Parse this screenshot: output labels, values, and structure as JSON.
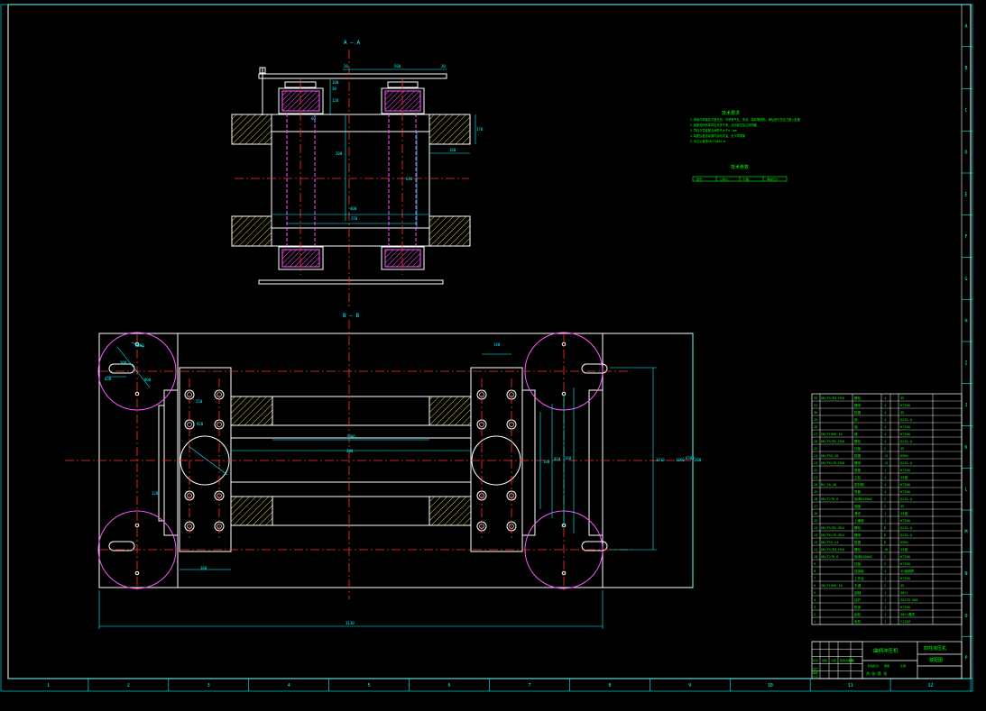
{
  "drawing": {
    "section_aa": "A — A",
    "section_bb": "B — B",
    "notes_title": "技术要求",
    "notes": [
      "1.焊接件焊缝应平整光滑，不得有气孔、夹渣、裂纹等缺陷，焊后进行去应力退火处理",
      "2.装配前所有零件应清洗干净，活动部位加注润滑脂",
      "3.导柱与导套配合间隙不大于0.1mm",
      "4.装配后各活动部件运动灵活，无卡滞现象",
      "5.未注公差按GB/T1804-m"
    ],
    "params_title": "技术参数",
    "params_cols": [
      "型号",
      "公称力",
      "行程",
      "滑块尺寸"
    ],
    "top_dims": [
      "20",
      "560",
      "20",
      "100",
      "30",
      "120",
      "60",
      "200",
      "400",
      "370",
      "640",
      "170",
      "160"
    ],
    "plan_dims": [
      "140",
      "R200",
      "300",
      "830",
      "900",
      "550",
      "920",
      "1000",
      "200",
      "100",
      "810",
      "1010",
      "200",
      "120",
      "360",
      "160",
      "6500"
    ],
    "overall_width": "3130",
    "overall_height": "1060",
    "ruler_bottom": [
      "1",
      "2",
      "3",
      "4",
      "5",
      "6",
      "7",
      "8",
      "9",
      "10",
      "11",
      "12"
    ],
    "ruler_right": [
      "A",
      "B",
      "C",
      "D",
      "E",
      "F",
      "G",
      "H",
      "I",
      "J",
      "K",
      "L",
      "M",
      "N",
      "O",
      "P"
    ]
  },
  "bom": {
    "rows": [
      [
        "32",
        "GB/T5783-M16",
        "螺栓",
        "4",
        "",
        "45"
      ],
      [
        "31",
        "",
        "螺母",
        "4",
        "",
        "HT200"
      ],
      [
        "30",
        "",
        "垫圈",
        "4",
        "",
        "35"
      ],
      [
        "29",
        "",
        "销",
        "4",
        "",
        "Q235-A"
      ],
      [
        "28",
        "",
        "轴",
        "4",
        "",
        "HT150"
      ],
      [
        "27",
        "GB/T1096-16",
        "键",
        "4",
        "",
        "HT200"
      ],
      [
        "26",
        "GB/T5782-M20",
        "螺栓",
        "4",
        "",
        "Q235-A"
      ],
      [
        "25",
        "",
        "挡板",
        "2",
        "",
        "45"
      ],
      [
        "24",
        "GB/T93-20",
        "垫圈",
        "12",
        "",
        "65Mn"
      ],
      [
        "23",
        "GB/T6170-M20",
        "螺母",
        "12",
        "",
        "Q235-A"
      ],
      [
        "22",
        "",
        "底座",
        "1",
        "",
        "HT150"
      ],
      [
        "21",
        "",
        "立柱",
        "4",
        "",
        "45钢"
      ],
      [
        "20",
        "Mc-16-40",
        "密封圈",
        "4",
        "",
        "HT300"
      ],
      [
        "19",
        "",
        "导套",
        "4",
        "",
        "HT200"
      ],
      [
        "18",
        "GB/T276-6",
        "轴承6208AC",
        "2",
        "",
        "Q235-A"
      ],
      [
        "17",
        "",
        "端盖",
        "2",
        "",
        "45"
      ],
      [
        "16",
        "",
        "滑块",
        "1",
        "",
        "45钢"
      ],
      [
        "15",
        "",
        "上横梁",
        "1",
        "",
        "HT200"
      ],
      [
        "14",
        "GB/T5782-M24",
        "螺栓",
        "8",
        "",
        "Q235-A"
      ],
      [
        "13",
        "GB/T6170-M24",
        "螺母",
        "8",
        "",
        "Q235-A"
      ],
      [
        "12",
        "GB/T93-24",
        "垫圈",
        "8",
        "",
        "65Mn"
      ],
      [
        "11",
        "GB/T5783-M16",
        "螺栓",
        "16",
        "",
        "45钢"
      ],
      [
        "10",
        "GB/T276-6",
        "轴承6306AC",
        "2",
        "",
        "HT200"
      ],
      [
        "9",
        "",
        "压板",
        "2",
        "",
        "HT150"
      ],
      [
        "8",
        "",
        "连接板",
        "4",
        "",
        "45钢调质"
      ],
      [
        "7",
        "",
        "工作台",
        "1",
        "",
        "HT150"
      ],
      [
        "6",
        "GB/T1096-10",
        "平键",
        "2",
        "",
        "45"
      ],
      [
        "5",
        "",
        "曲轴",
        "1",
        "",
        "40Cr"
      ],
      [
        "4",
        "",
        "连杆",
        "1",
        "",
        "ZG270-500"
      ],
      [
        "3",
        "",
        "机身",
        "1",
        "",
        "HT250"
      ],
      [
        "2",
        "",
        "齿轮",
        "1",
        "",
        "40Cr调质"
      ],
      [
        "1",
        "",
        "电机",
        "1",
        "",
        "Y132M"
      ]
    ],
    "title_left": "曲柄冲压机",
    "title_right_top": "四柱液压机",
    "title_right_bottom": "装配图",
    "stamp_cols": [
      "标记",
      "处数",
      "分区",
      "更改文件号",
      "签名",
      "年月日"
    ],
    "stamp_rows": [
      "设计",
      "审核",
      "工艺"
    ],
    "weight_labels": [
      "阶段标记",
      "重量",
      "比例"
    ],
    "sheet": "共 张 第 张"
  },
  "colors": {
    "line": "#ffffff",
    "dim": "#00ffff",
    "center": "#ff3333",
    "hidden": "#ff55ff",
    "hatch": "#d4d43a",
    "text": "#00ff00"
  }
}
